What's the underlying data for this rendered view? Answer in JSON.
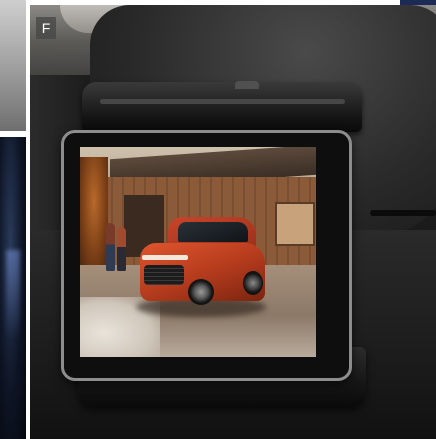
{
  "photo": {
    "panel_label": "F",
    "label_color": "#ffffff",
    "subject": "tablet-in-headrest-holder",
    "screen_subject": "red-suv-by-barn"
  }
}
